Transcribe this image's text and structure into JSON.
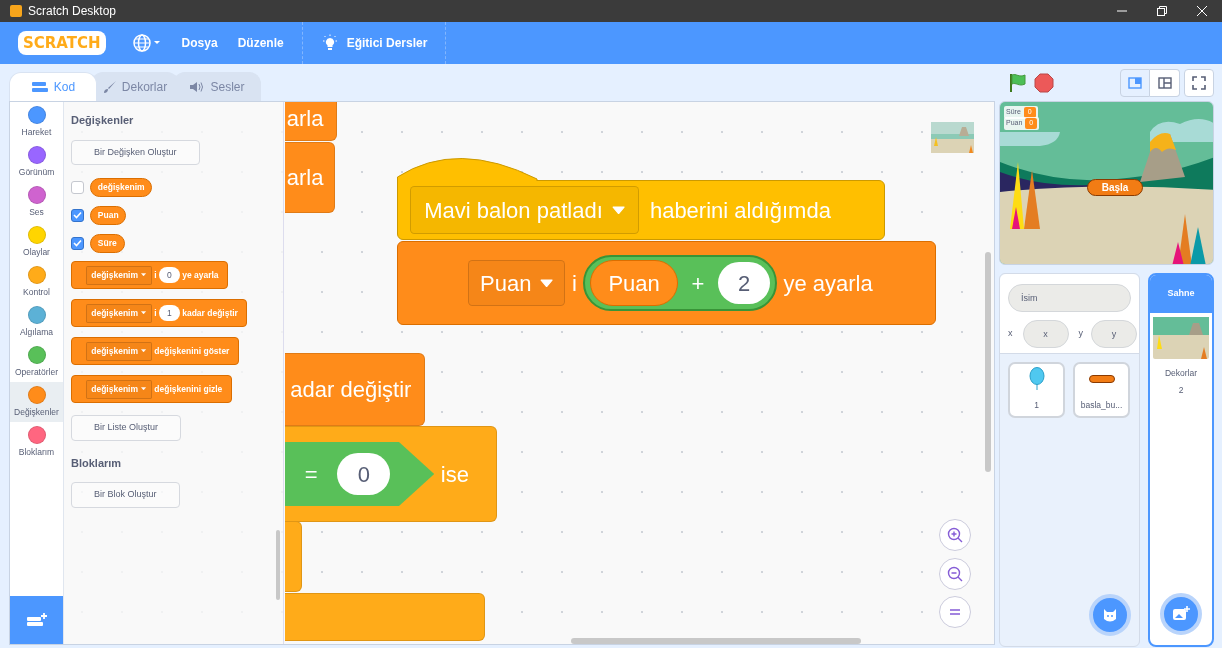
{
  "window": {
    "title": "Scratch Desktop"
  },
  "menu_bar": {
    "logo": "SCRATCH",
    "items": [
      {
        "label": "Dosya"
      },
      {
        "label": "Düzenle"
      }
    ],
    "tutorials": "Eğitici Dersler"
  },
  "tabs": [
    {
      "label": "Kod",
      "selected": true
    },
    {
      "label": "Dekorlar",
      "selected": false
    },
    {
      "label": "Sesler",
      "selected": false
    }
  ],
  "categories": [
    {
      "label": "Hareket",
      "color": "#4c97ff",
      "selected": false
    },
    {
      "label": "Görünüm",
      "color": "#9966ff",
      "selected": false
    },
    {
      "label": "Ses",
      "color": "#cf63cf",
      "selected": false
    },
    {
      "label": "Olaylar",
      "color": "#ffd500",
      "selected": false
    },
    {
      "label": "Kontrol",
      "color": "#ffab19",
      "selected": false
    },
    {
      "label": "Algılama",
      "color": "#5cb1d6",
      "selected": false
    },
    {
      "label": "Operatörler",
      "color": "#59c059",
      "selected": false
    },
    {
      "label": "Değişkenler",
      "color": "#ff8c1a",
      "selected": true
    },
    {
      "label": "Bloklarım",
      "color": "#ff6680",
      "selected": false
    }
  ],
  "flyout": {
    "variables_heading": "Değişkenler",
    "make_variable": "Bir Değişken Oluştur",
    "variables": [
      {
        "name": "değişkenim",
        "checked": false
      },
      {
        "name": "Puan",
        "checked": true
      },
      {
        "name": "Süre",
        "checked": true
      }
    ],
    "blocks": [
      {
        "parts": [
          {
            "kind": "dropdown",
            "text": "değişkenim"
          },
          {
            "kind": "text",
            "text": "i"
          },
          {
            "kind": "number",
            "text": "0"
          },
          {
            "kind": "text",
            "text": "ye ayarla"
          }
        ]
      },
      {
        "parts": [
          {
            "kind": "dropdown",
            "text": "değişkenim"
          },
          {
            "kind": "text",
            "text": "i"
          },
          {
            "kind": "number",
            "text": "1"
          },
          {
            "kind": "text",
            "text": "kadar değiştir"
          }
        ]
      },
      {
        "parts": [
          {
            "kind": "dropdown",
            "text": "değişkenim"
          },
          {
            "kind": "text",
            "text": "değişkenini göster"
          }
        ]
      },
      {
        "parts": [
          {
            "kind": "dropdown",
            "text": "değişkenim"
          },
          {
            "kind": "text",
            "text": "değişkenini gizle"
          }
        ]
      }
    ],
    "make_list": "Bir Liste Oluştur",
    "my_blocks_heading": "Bloklarım",
    "make_block": "Bir Blok Oluştur"
  },
  "workspace": {
    "background_blocks": [
      {
        "color": "#ff8c1a",
        "parts": [
          {
            "kind": "text",
            "text": "arla"
          }
        ]
      },
      {
        "color": "#ff8c1a",
        "parts": [
          {
            "kind": "text",
            "text": "arla"
          }
        ]
      },
      {
        "color": "#ff8c1a",
        "parts": [
          {
            "kind": "text",
            "text": "adar değiştir"
          }
        ]
      },
      {
        "color": "#ffab19",
        "parts": [
          {
            "kind": "boolean",
            "parts": [
              {
                "kind": "text",
                "text": "="
              },
              {
                "kind": "number",
                "text": "0"
              }
            ]
          },
          {
            "kind": "text",
            "text": "ise"
          }
        ]
      },
      {
        "color": "#ffab19"
      },
      {
        "color": "#ffab19"
      }
    ],
    "script": [
      {
        "kind": "hat",
        "color": "#ffbf00",
        "parts": [
          {
            "kind": "dropdown",
            "text": "Mavi balon patladı"
          },
          {
            "kind": "text",
            "text": "haberini aldığımda"
          }
        ]
      },
      {
        "kind": "stack",
        "color": "#ff8c1a",
        "parts": [
          {
            "kind": "dropdown",
            "text": "Puan"
          },
          {
            "kind": "text",
            "text": "i"
          },
          {
            "kind": "operator",
            "parts": [
              {
                "kind": "reporter",
                "text": "Puan"
              },
              {
                "kind": "text",
                "text": "+"
              },
              {
                "kind": "number",
                "text": "2"
              }
            ]
          },
          {
            "kind": "text",
            "text": "ye ayarla"
          }
        ]
      }
    ]
  },
  "stage": {
    "monitors": [
      {
        "label": "Süre",
        "value": "0"
      },
      {
        "label": "Puan",
        "value": "0"
      }
    ],
    "button": "Başla"
  },
  "sprite_info": {
    "name_placeholder": "İsim",
    "x_label": "x",
    "x_placeholder": "x",
    "y_label": "y",
    "y_placeholder": "y"
  },
  "sprites": [
    {
      "name": "1",
      "selected": false
    },
    {
      "name": "basla_bu...",
      "selected": false
    }
  ],
  "stage_pane": {
    "title": "Sahne",
    "backdrops_label": "Dekorlar",
    "backdrops_count": "2"
  }
}
